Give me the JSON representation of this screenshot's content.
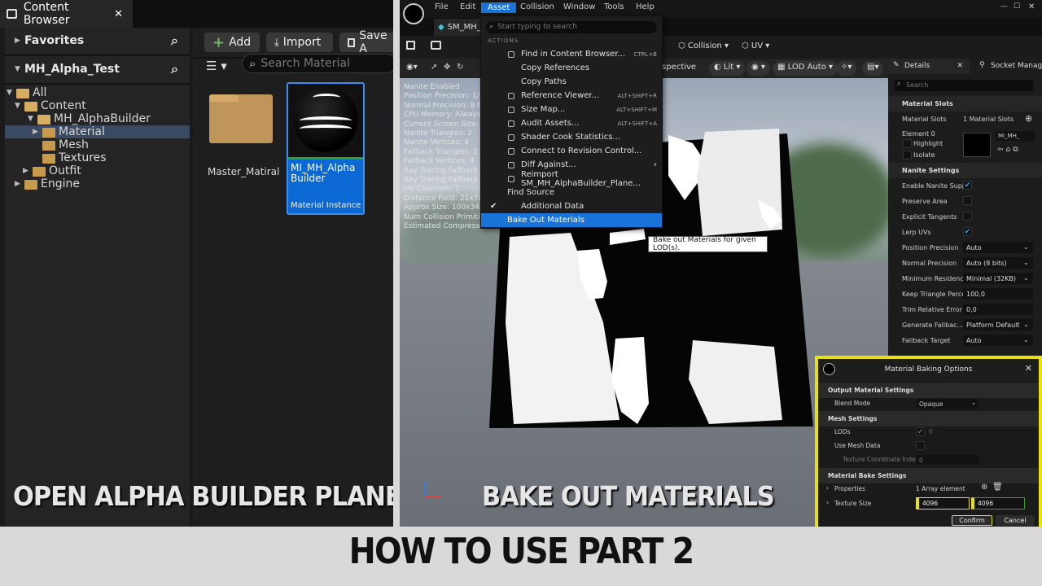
{
  "left_panel": {
    "tab_title": "Content Browser",
    "favorites": "Favorites",
    "project": "MH_Alpha_Test",
    "tree": [
      {
        "label": "All",
        "indent": 0
      },
      {
        "label": "Content",
        "indent": 1
      },
      {
        "label": "MH_AlphaBuilder",
        "indent": 2
      },
      {
        "label": "Material",
        "indent": 3
      },
      {
        "label": "Mesh",
        "indent": 3
      },
      {
        "label": "Textures",
        "indent": 3
      },
      {
        "label": "Outfit",
        "indent": 2
      },
      {
        "label": "Engine",
        "indent": 1
      }
    ],
    "toolbar": {
      "add": "Add",
      "import": "Import",
      "save": "Save A"
    },
    "search_placeholder": "Search Material",
    "assets": [
      {
        "name": "Master_Matiral",
        "type": ""
      },
      {
        "name": "MI_MH_Alpha Builder",
        "type": "Material Instance"
      }
    ],
    "caption": "OPEN ALPHA BUILDER PLANE"
  },
  "editor": {
    "menu": [
      "File",
      "Edit",
      "Asset",
      "Collision",
      "Window",
      "Tools",
      "Help"
    ],
    "active_menu": "Asset",
    "tab_title": "SM_MH_",
    "toolbar": {
      "collision": "Collision",
      "uv": "UV"
    },
    "viewport_toolbar": {
      "perspective": "rspective",
      "lit": "Lit",
      "lod": "LOD Auto"
    },
    "stats": [
      "Nanite Enabled",
      "Position Precision: 1/1",
      "Normal Precision: 8 bi",
      "CPU Memory: Always",
      "Current Screen Size: 0",
      "Nanite Triangles: 2",
      "Nanite Vertices: 4",
      "Fallback Triangles: 2",
      "Fallback Vertices: 4",
      "Ray Tracing Fallback T",
      "Ray Tracing Fallback V",
      "UV Channels: 1",
      "Distance Field: 21x7x",
      "Approx Size: 100x34x",
      "Num Collision Primitiv",
      "Estimated Compresse"
    ],
    "caption": "BAKE OUT MATERIALS",
    "asset_menu": {
      "search_placeholder": "Start typing to search",
      "section": "ACTIONS",
      "items": [
        {
          "label": "Find in Content Browser...",
          "shortcut": "CTRL+B"
        },
        {
          "label": "Copy References",
          "shortcut": ""
        },
        {
          "label": "Copy Paths",
          "shortcut": ""
        },
        {
          "label": "Reference Viewer...",
          "shortcut": "ALT+SHIFT+R"
        },
        {
          "label": "Size Map...",
          "shortcut": "ALT+SHIFT+M"
        },
        {
          "label": "Audit Assets...",
          "shortcut": "ALT+SHIFT+A"
        },
        {
          "label": "Shader Cook Statistics...",
          "shortcut": ""
        },
        {
          "label": "Connect to Revision Control...",
          "shortcut": ""
        },
        {
          "label": "Diff Against...",
          "shortcut": ""
        },
        {
          "label": "Reimport SM_MH_AlphaBuilder_Plane...",
          "shortcut": ""
        },
        {
          "label": "Find Source",
          "shortcut": ""
        },
        {
          "label": "Additional Data",
          "shortcut": ""
        },
        {
          "label": "Bake Out Materials",
          "shortcut": ""
        }
      ],
      "tooltip": "Bake out Materials for given LOD(s)."
    }
  },
  "details": {
    "tab_title": "Details",
    "tab2_title": "Socket Manage",
    "search_placeholder": "Search",
    "material_slots_section": "Material Slots",
    "material_slots_label": "Material Slots",
    "material_slots_value": "1 Material Slots",
    "element0": "Element 0",
    "highlight": "Highlight",
    "isolate": "Isolate",
    "material_name": "MI_MH_",
    "nanite_section": "Nanite Settings",
    "rows": [
      {
        "label": "Enable Nanite Supp",
        "kind": "check",
        "value": "",
        "checked": true
      },
      {
        "label": "Preserve Area",
        "kind": "check",
        "value": "",
        "checked": false
      },
      {
        "label": "Explicit Tangents",
        "kind": "check",
        "value": "",
        "checked": false
      },
      {
        "label": "Lerp UVs",
        "kind": "check",
        "value": "",
        "checked": true
      },
      {
        "label": "Position Precision",
        "kind": "select",
        "value": "Auto"
      },
      {
        "label": "Normal Precision",
        "kind": "select",
        "value": "Auto (8 bits)"
      },
      {
        "label": "Minimum Residenc",
        "kind": "select",
        "value": "Minimal (32KB)"
      },
      {
        "label": "Keep Triangle Perce",
        "kind": "field",
        "value": "100,0"
      },
      {
        "label": "Trim Relative Error",
        "kind": "field",
        "value": "0,0"
      },
      {
        "label": "Generate Fallbac...",
        "kind": "select",
        "value": "Platform Default"
      },
      {
        "label": "Fallback Target",
        "kind": "select",
        "value": "Auto"
      }
    ]
  },
  "bake_dialog": {
    "title": "Material Baking Options",
    "output_section": "Output Material Settings",
    "blend_mode_label": "Blend Mode",
    "blend_mode_value": "Opaque",
    "mesh_section": "Mesh Settings",
    "lods_label": "LODs",
    "lods_value": "0",
    "use_mesh_data_label": "Use Mesh Data",
    "tex_coord_label": "Texture Coordinate Index",
    "tex_coord_value": "0",
    "bake_section": "Material Bake Settings",
    "properties_label": "Properties",
    "properties_value": "1 Array element",
    "texture_size_label": "Texture Size",
    "texture_size_x": "4096",
    "texture_size_y": "4096",
    "confirm": "Confirm",
    "cancel": "Cancel",
    "highlight_color": "#e8e010"
  },
  "footer": {
    "caption": "HOW TO USE  PART 2"
  }
}
